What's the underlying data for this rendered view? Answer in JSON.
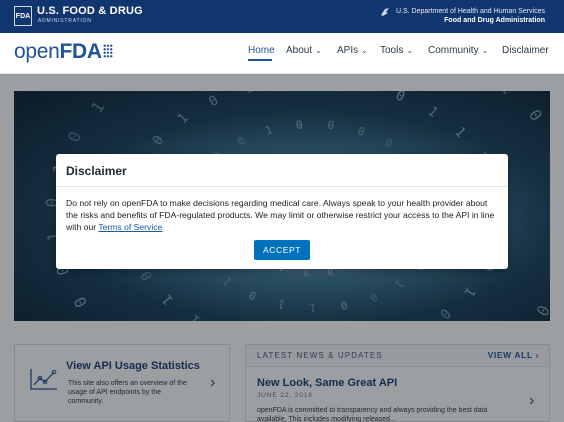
{
  "fda_bar": {
    "logo_text": "FDA",
    "name": "U.S. FOOD & DRUG",
    "sub": "ADMINISTRATION",
    "hhs_line1": "U.S. Department of Health and Human Services",
    "hhs_line2": "Food and Drug Administration",
    "bg_color": "#11356f"
  },
  "nav": {
    "brand_open": "open",
    "brand_fda": "FDA",
    "items": [
      {
        "label": "Home",
        "active": true
      },
      {
        "label": "About",
        "dropdown": true
      },
      {
        "label": "APIs",
        "dropdown": true
      },
      {
        "label": "Tools",
        "dropdown": true
      },
      {
        "label": "Community",
        "dropdown": true
      },
      {
        "label": "Disclaimer"
      }
    ],
    "accent_color": "#205493"
  },
  "cards": {
    "usage": {
      "title": "View API Usage Statistics",
      "text": "This site also offers an overview of the usage of API endpoints by the community."
    },
    "news": {
      "heading": "LATEST NEWS & UPDATES",
      "view_all": "VIEW ALL",
      "title": "New Look, Same Great API",
      "date": "JUNE 22, 2018",
      "text": "openFDA is committed to transparency and always providing the best data available. This includes modifying released..."
    }
  },
  "modal": {
    "title": "Disclaimer",
    "body_text": "Do not rely on openFDA to make decisions regarding medical care. Always speak to your health provider about the risks and benefits of FDA-regulated products. We may limit or otherwise restrict your access to the API in line with our ",
    "link_text": "Terms of Service",
    "accept_label": "ACCEPT",
    "button_color": "#0071bc"
  },
  "icons": {
    "hhs": "eagle-icon",
    "usage": "line-chart-icon",
    "arrow": "chevron-right-icon",
    "dropdown": "chevron-down-icon"
  }
}
